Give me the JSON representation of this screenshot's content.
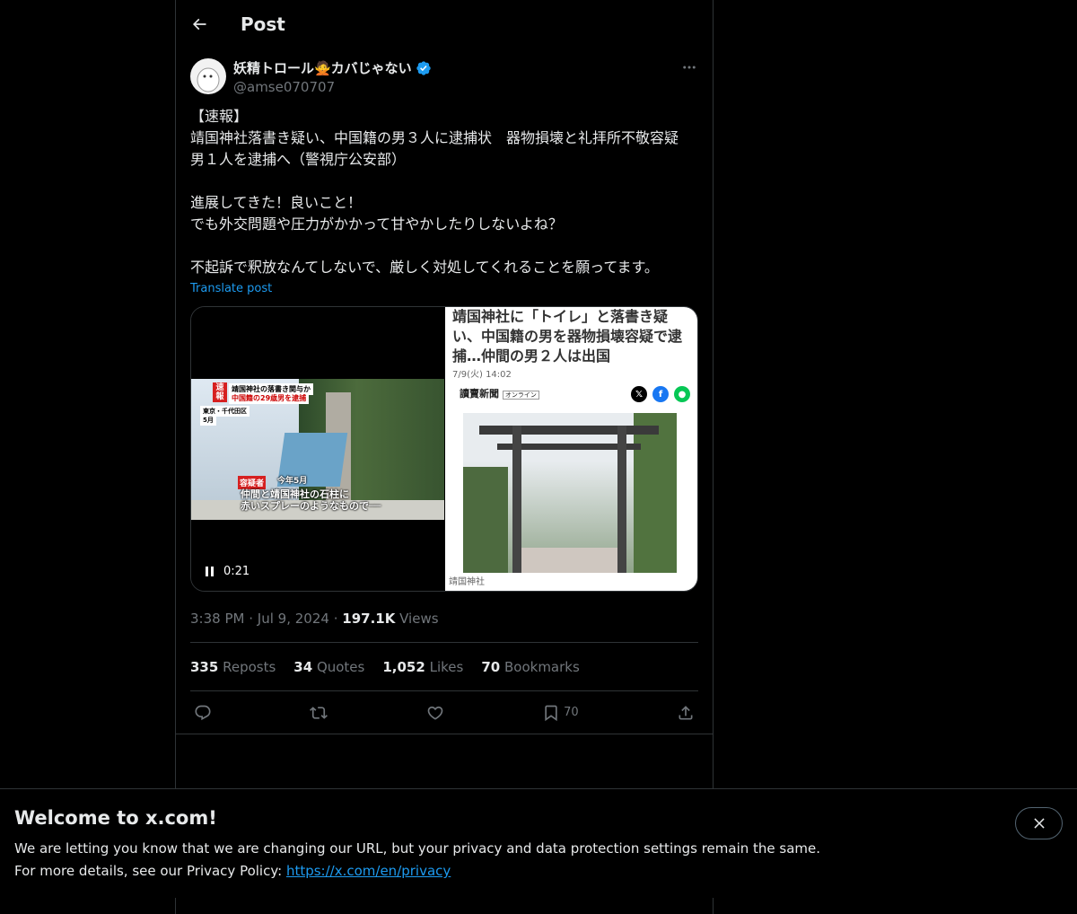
{
  "header": {
    "title": "Post"
  },
  "author": {
    "display_name": "妖精トロール🙅カバじゃない",
    "handle": "@amse070707",
    "verified": true
  },
  "post": {
    "text": "【速報】\n靖国神社落書き疑い、中国籍の男３人に逮捕状　器物損壊と礼拝所不敬容疑　男１人を逮捕へ（警視庁公安部）\n\n進展してきた！良いこと！\nでも外交問題や圧力がかかって甘やかしたりしないよね？\n\n不起訴で釈放なんてしないで、厳しく対処してくれることを願ってます。",
    "translate_label": "Translate post"
  },
  "media": {
    "video": {
      "time": "0:21",
      "caption_top_badge": "速報",
      "caption_top_line1": "靖国神社の落書き関与か",
      "caption_top_line2": "中国籍の29歳男を逮捕",
      "caption_location_line1": "東京・千代田区",
      "caption_location_line2": "5月",
      "caption_suspect": "容疑者",
      "caption_month": "今年5月",
      "caption_bottom_line1": "仲間と靖国神社の石柱に",
      "caption_bottom_line2": "赤いスプレーのようなもので──"
    },
    "article": {
      "title": "靖国神社に「トイレ」と落書き疑い、中国籍の男を器物損壊容疑で逮捕…仲間の男２人は出国",
      "date": "7/9(火) 14:02",
      "brand": "讀賣新聞",
      "brand_sub": "オンライン",
      "caption": "靖国神社"
    }
  },
  "meta": {
    "time": "3:38 PM",
    "separator": "·",
    "date": "Jul 9, 2024",
    "views_count": "197.1K",
    "views_label": "Views"
  },
  "stats": {
    "reposts_count": "335",
    "reposts_label": "Reposts",
    "quotes_count": "34",
    "quotes_label": "Quotes",
    "likes_count": "1,052",
    "likes_label": "Likes",
    "bookmarks_count": "70",
    "bookmarks_label": "Bookmarks"
  },
  "actions": {
    "bookmark_count": "70"
  },
  "banner": {
    "title": "Welcome to x.com!",
    "line1": "We are letting you know that we are changing our URL, but your privacy and data protection settings remain the same.",
    "line2_prefix": "For more details, see our Privacy Policy: ",
    "link": "https://x.com/en/privacy"
  },
  "colors": {
    "background": "#000000",
    "text_primary": "#e7e9ea",
    "text_secondary": "#71767b",
    "accent": "#1d9bf0",
    "border": "#2f3336"
  },
  "icons": [
    "back-arrow-icon",
    "verified-badge-icon",
    "more-icon",
    "pause-icon",
    "reply-icon",
    "repost-icon",
    "like-icon",
    "bookmark-icon",
    "share-icon",
    "close-icon"
  ]
}
